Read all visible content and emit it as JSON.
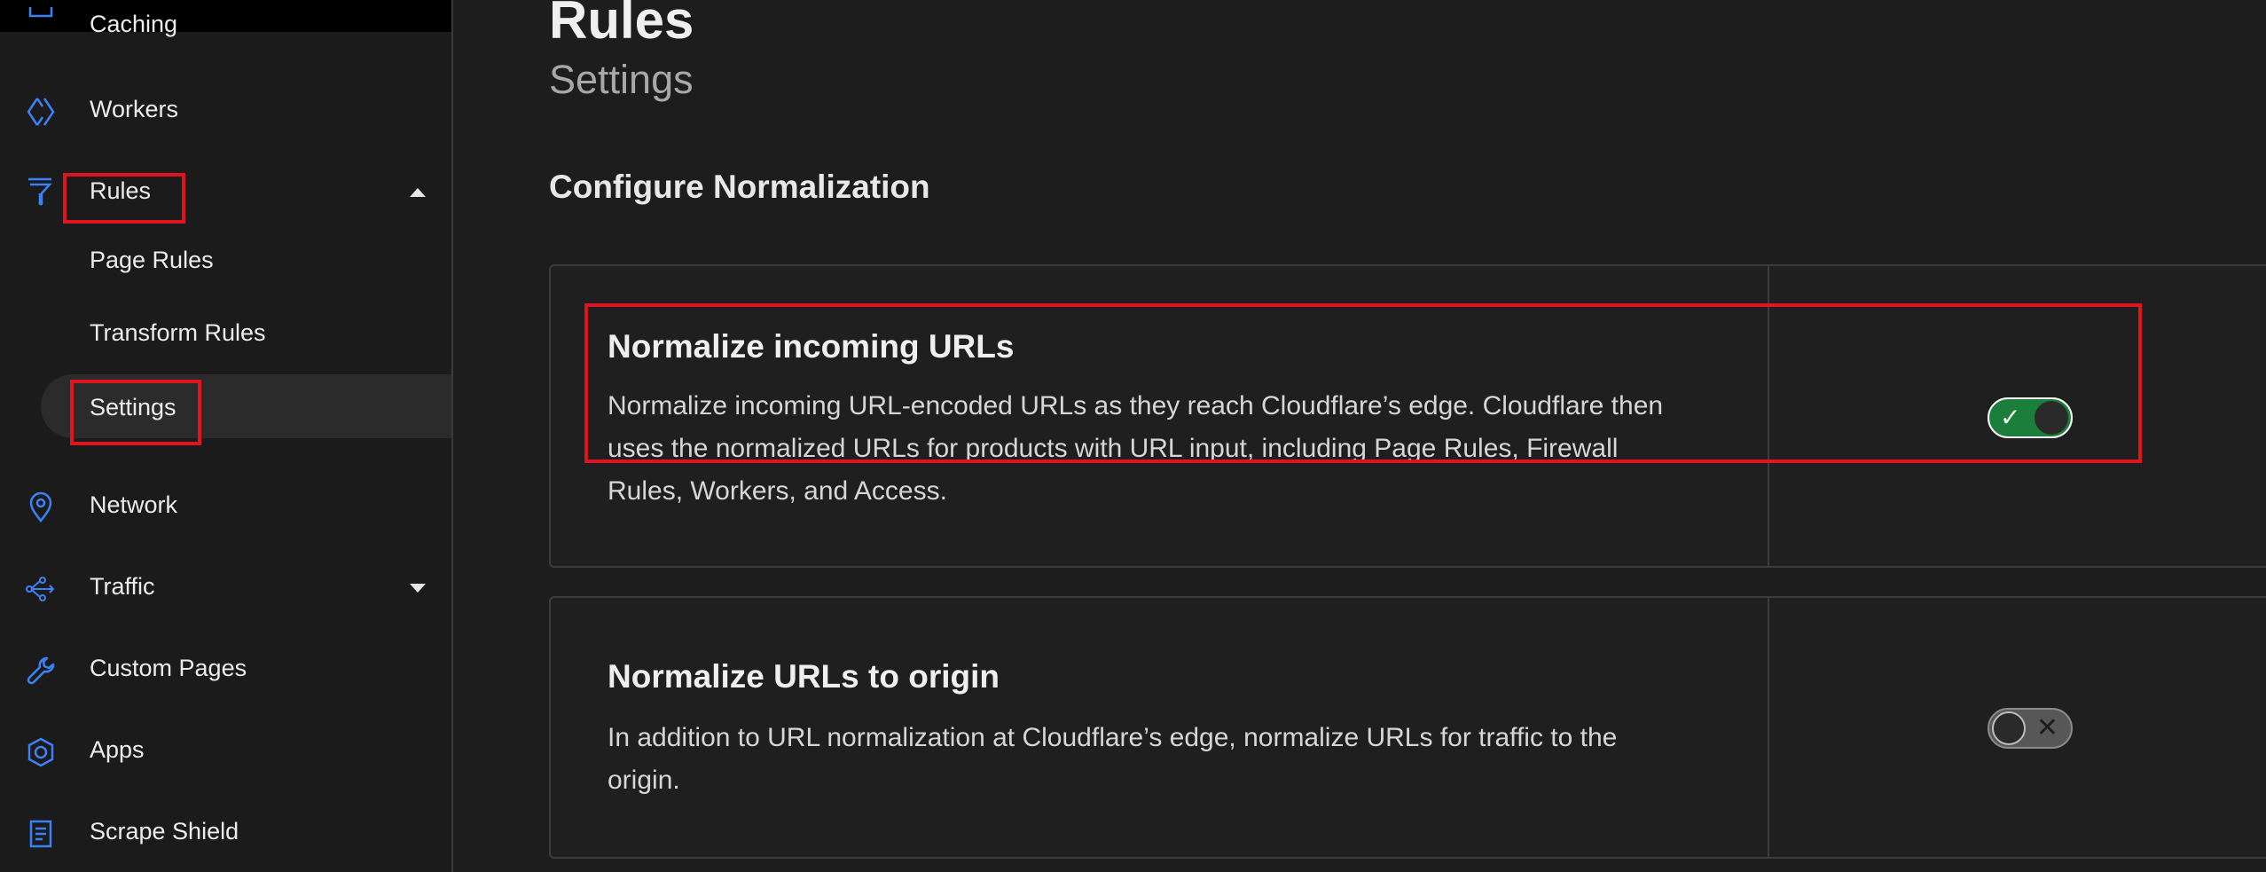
{
  "sidebar": {
    "items": [
      {
        "label": "Caching",
        "icon": "caching-icon"
      },
      {
        "label": "Workers",
        "icon": "workers-icon"
      },
      {
        "label": "Rules",
        "icon": "rules-icon",
        "expanded": true
      },
      {
        "label": "Network",
        "icon": "network-icon"
      },
      {
        "label": "Traffic",
        "icon": "traffic-icon",
        "expanded": false
      },
      {
        "label": "Custom Pages",
        "icon": "custom-pages-icon"
      },
      {
        "label": "Apps",
        "icon": "apps-icon"
      },
      {
        "label": "Scrape Shield",
        "icon": "scrape-shield-icon"
      }
    ],
    "subitems": [
      {
        "label": "Page Rules"
      },
      {
        "label": "Transform Rules"
      },
      {
        "label": "Settings",
        "active": true
      }
    ]
  },
  "main": {
    "title": "Rules",
    "subtitle": "Settings",
    "section_title": "Configure Normalization",
    "cards": [
      {
        "title": "Normalize incoming URLs",
        "description": "Normalize incoming URL-encoded URLs as they reach Cloudflare’s edge. Cloudflare then uses the normalized URLs for products with URL input, including Page Rules, Firewall Rules, Workers, and Access.",
        "enabled": true,
        "toggle_symbol": "✓"
      },
      {
        "title": "Normalize URLs to origin",
        "description": "In addition to URL normalization at Cloudflare’s edge, normalize URLs for traffic to the origin.",
        "enabled": false,
        "toggle_symbol": "✕"
      }
    ]
  },
  "colors": {
    "icon_blue": "#3b82f6",
    "toggle_on": "#1b7f3b",
    "toggle_off": "#575757",
    "highlight_red": "#e0141e"
  }
}
